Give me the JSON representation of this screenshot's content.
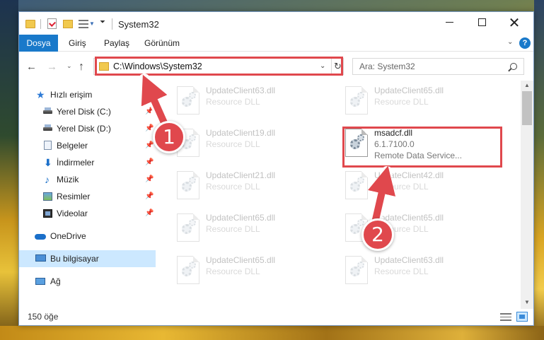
{
  "window": {
    "title": "System32",
    "controls": {
      "minimize": "—",
      "maximize": "",
      "close": "✕"
    }
  },
  "ribbon": {
    "tabs": [
      "Dosya",
      "Giriş",
      "Paylaş",
      "Görünüm"
    ],
    "help": "?"
  },
  "navigation": {
    "address": "C:\\Windows\\System32",
    "search_placeholder": "Ara: System32"
  },
  "sidebar": {
    "items": [
      {
        "label": "Hızlı erişim",
        "icon": "star-icon",
        "pinned": false
      },
      {
        "label": "Yerel Disk (C:)",
        "icon": "disk-icon",
        "pinned": true
      },
      {
        "label": "Yerel Disk (D:)",
        "icon": "disk-icon",
        "pinned": true
      },
      {
        "label": "Belgeler",
        "icon": "documents-icon",
        "pinned": true
      },
      {
        "label": "İndirmeler",
        "icon": "download-icon",
        "pinned": true
      },
      {
        "label": "Müzik",
        "icon": "music-icon",
        "pinned": true
      },
      {
        "label": "Resimler",
        "icon": "pictures-icon",
        "pinned": true
      },
      {
        "label": "Videolar",
        "icon": "video-icon",
        "pinned": true
      },
      {
        "label": "OneDrive",
        "icon": "cloud-icon",
        "pinned": false
      },
      {
        "label": "Bu bilgisayar",
        "icon": "computer-icon",
        "pinned": false,
        "selected": true
      },
      {
        "label": "Ağ",
        "icon": "network-icon",
        "pinned": false
      }
    ]
  },
  "files": [
    {
      "name": "UpdateClient63.dll",
      "type": "Resource DLL",
      "dimmed": true
    },
    {
      "name": "UpdateClient65.dll",
      "type": "Resource DLL",
      "dimmed": true
    },
    {
      "name": "UpdateClient19.dll",
      "type": "Resource DLL",
      "dimmed": true
    },
    {
      "name": "msadcf.dll",
      "version": "6.1.7100.0",
      "type": "Remote Data Service...",
      "dimmed": false,
      "highlighted": true
    },
    {
      "name": "UpdateClient21.dll",
      "type": "Resource DLL",
      "dimmed": true
    },
    {
      "name": "UpdateClient42.dll",
      "type": "Resource DLL",
      "dimmed": true
    },
    {
      "name": "UpdateClient65.dll",
      "type": "Resource DLL",
      "dimmed": true
    },
    {
      "name": "UpdateClient65.dll",
      "type": "Resource DLL",
      "dimmed": true
    },
    {
      "name": "UpdateClient65.dll",
      "type": "Resource DLL",
      "dimmed": true
    },
    {
      "name": "UpdateClient63.dll",
      "type": "Resource DLL",
      "dimmed": true
    }
  ],
  "status": {
    "count": "150 öğe"
  },
  "annotations": {
    "step1": "1",
    "step2": "2",
    "accent_color": "#e0484d"
  },
  "colors": {
    "file_tab": "#1979ca",
    "selected": "#cce8ff"
  }
}
